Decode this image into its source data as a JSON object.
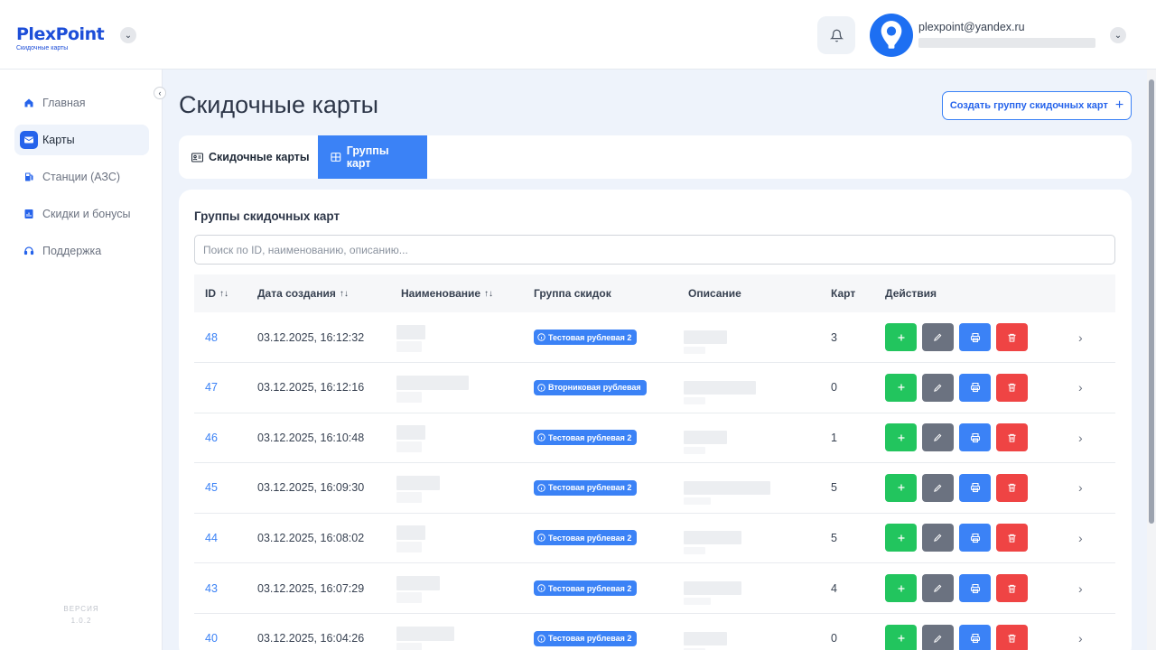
{
  "header": {
    "logo_text": "PlexPoint",
    "logo_subtitle": "Скидочные карты",
    "user_email": "plexpoint@yandex.ru"
  },
  "sidebar": {
    "items": [
      {
        "label": "Главная",
        "icon": "home-icon",
        "active": false
      },
      {
        "label": "Карты",
        "icon": "card-icon",
        "active": true
      },
      {
        "label": "Станции (АЗС)",
        "icon": "fuel-icon",
        "active": false
      },
      {
        "label": "Скидки и бонусы",
        "icon": "chart-icon",
        "active": false
      },
      {
        "label": "Поддержка",
        "icon": "headset-icon",
        "active": false
      }
    ],
    "version_label": "ВЕРСИЯ",
    "version_value": "1.0.2"
  },
  "main": {
    "title": "Скидочные карты",
    "create_button": "Создать группу скидочных карт",
    "tabs": [
      {
        "label": "Скидочные карты",
        "active": false
      },
      {
        "label": "Группы карт",
        "active": true
      }
    ],
    "section_title": "Группы скидочных карт",
    "search_placeholder": "Поиск по ID, наименованию, описанию...",
    "columns": [
      "ID",
      "Дата создания",
      "Наименование",
      "Группа скидок",
      "Описание",
      "Карт",
      "Действия"
    ],
    "rows": [
      {
        "id": "48",
        "created": "03.12.2025, 16:12:32",
        "discount_group": "Тестовая рублевая 2",
        "cards": "3"
      },
      {
        "id": "47",
        "created": "03.12.2025, 16:12:16",
        "discount_group": "Вторниковая рублевая",
        "cards": "0"
      },
      {
        "id": "46",
        "created": "03.12.2025, 16:10:48",
        "discount_group": "Тестовая рублевая 2",
        "cards": "1"
      },
      {
        "id": "45",
        "created": "03.12.2025, 16:09:30",
        "discount_group": "Тестовая рублевая 2",
        "cards": "5"
      },
      {
        "id": "44",
        "created": "03.12.2025, 16:08:02",
        "discount_group": "Тестовая рублевая 2",
        "cards": "5"
      },
      {
        "id": "43",
        "created": "03.12.2025, 16:07:29",
        "discount_group": "Тестовая рублевая 2",
        "cards": "4"
      },
      {
        "id": "40",
        "created": "03.12.2025, 16:04:26",
        "discount_group": "Тестовая рублевая 2",
        "cards": "0"
      }
    ]
  },
  "colors": {
    "accent": "#3b82f6",
    "add": "#22c55e",
    "edit": "#6b7280",
    "print": "#3b82f6",
    "delete": "#ef4444"
  }
}
